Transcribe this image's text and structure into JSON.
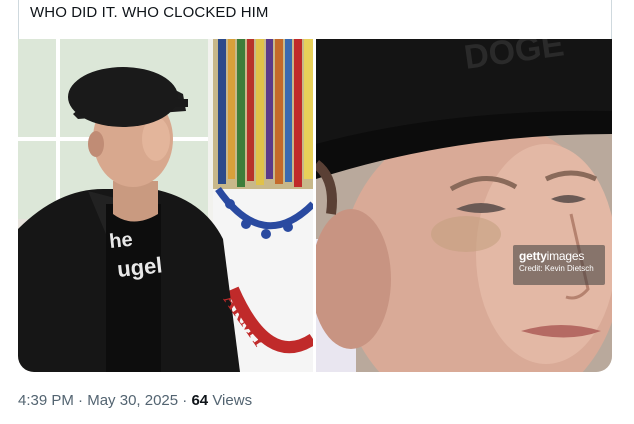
{
  "tweet": {
    "text": "WHO DID IT. WHO CLOCKED HIM",
    "images": [
      {
        "description": "man-in-cap-and-black-shirt-near-flags",
        "shirt_text_line1": "he",
        "shirt_text_line2": "ugel",
        "flag_text": "ARMY"
      },
      {
        "description": "close-up-face-with-black-cap",
        "watermark_brand": "getty",
        "watermark_brand_suffix": "images",
        "watermark_credit": "Credit: Kevin Dietsch"
      }
    ],
    "time": "4:39 PM",
    "separator": "·",
    "date": "May 30, 2025",
    "views_count": "64",
    "views_label": "Views"
  },
  "colors": {
    "text_primary": "#0f1419",
    "text_secondary": "#536471",
    "border": "#cfd9de"
  }
}
